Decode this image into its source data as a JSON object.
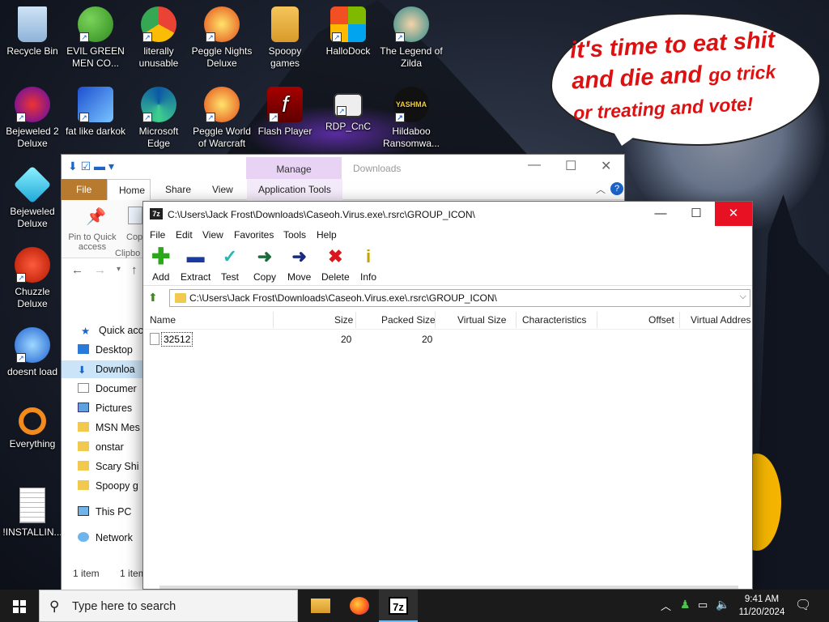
{
  "desktop": {
    "bubble": {
      "line1": "it's time to eat shit",
      "line2a": "and die and ",
      "line2b": "go trick",
      "line3": "or treating and vote!"
    },
    "icons": [
      {
        "label": "Recycle Bin",
        "icon": "recycle-bin-icon"
      },
      {
        "label": "EVIL GREEN MEN CO...",
        "icon": "messenger-icon"
      },
      {
        "label": "literally unusable",
        "icon": "chrome-icon"
      },
      {
        "label": "Peggle Nights Deluxe",
        "icon": "peggle-icon"
      },
      {
        "label": "Spoopy games",
        "icon": "folder-icon"
      },
      {
        "label": "HalloDock",
        "icon": "windows-logo-icon"
      },
      {
        "label": "The Legend of Zilda",
        "icon": "game-icon"
      },
      {
        "label": "Bejeweled 2 Deluxe",
        "icon": "bejeweled-icon"
      },
      {
        "label": "fat like darkok",
        "icon": "mpl-icon"
      },
      {
        "label": "Microsoft Edge",
        "icon": "edge-icon"
      },
      {
        "label": "Peggle World of Warcraft",
        "icon": "peggle-icon"
      },
      {
        "label": "Flash Player",
        "icon": "flash-icon"
      },
      {
        "label": "RDP_CnC",
        "icon": "remote-desktop-icon"
      },
      {
        "label": "Hildaboo Ransomwa...",
        "icon": "yashma-icon"
      },
      {
        "label": "Bejeweled Deluxe",
        "icon": "gem-icon"
      },
      {
        "label": "Chuzzle Deluxe",
        "icon": "chuzzle-icon"
      },
      {
        "label": "doesnt load",
        "icon": "thunderbird-icon"
      },
      {
        "label": "Everything",
        "icon": "search-icon"
      },
      {
        "label": "!INSTALLIN...",
        "icon": "text-file-icon"
      }
    ]
  },
  "explorer": {
    "manage": "Manage",
    "title": "Downloads",
    "tabs": {
      "file": "File",
      "home": "Home",
      "share": "Share",
      "view": "View",
      "apptools": "Application Tools"
    },
    "ribbon": {
      "pin": "Pin to Quick access",
      "copy": "Cop",
      "clipboard": "Clipbo"
    },
    "sidebar": [
      "Quick acce",
      "Desktop",
      "Downloa",
      "Documer",
      "Pictures",
      "MSN Mes",
      "onstar",
      "Scary Shi",
      "Spoopy g",
      "This PC",
      "Network"
    ],
    "status1": "1 item",
    "status2": "1 item"
  },
  "sevenzip": {
    "title": "C:\\Users\\Jack Frost\\Downloads\\Caseoh.Virus.exe\\.rsrc\\GROUP_ICON\\",
    "menu": [
      "File",
      "Edit",
      "View",
      "Favorites",
      "Tools",
      "Help"
    ],
    "toolbar": [
      "Add",
      "Extract",
      "Test",
      "Copy",
      "Move",
      "Delete",
      "Info"
    ],
    "address": "C:\\Users\\Jack Frost\\Downloads\\Caseoh.Virus.exe\\.rsrc\\GROUP_ICON\\",
    "columns": {
      "name": "Name",
      "size": "Size",
      "packed": "Packed Size",
      "virtual": "Virtual Size",
      "chars": "Characteristics",
      "offset": "Offset",
      "vaddr": "Virtual Addres"
    },
    "rows": [
      {
        "name": "32512",
        "size": "20",
        "packed": "20"
      }
    ]
  },
  "taskbar": {
    "search_placeholder": "Type here to search",
    "time": "9:41 AM",
    "date": "11/20/2024"
  },
  "colors": {
    "accent": "#0078d7",
    "close": "#e81123",
    "file_tab": "#b87a2e",
    "manage": "#e8d3f4"
  }
}
